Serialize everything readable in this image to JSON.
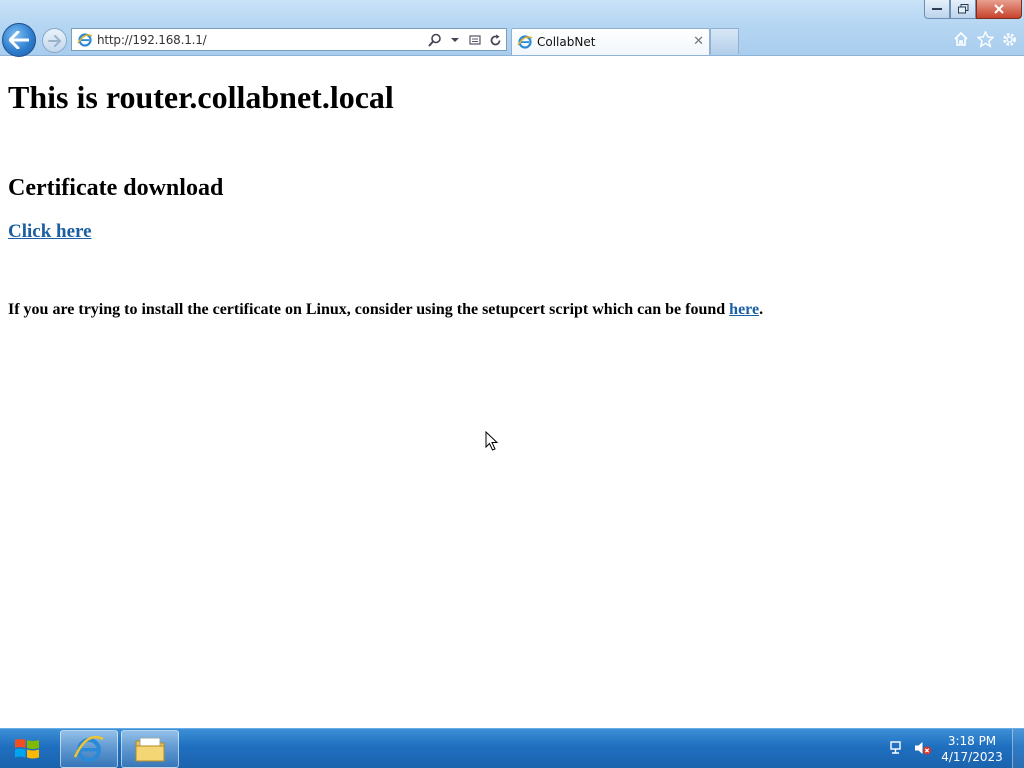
{
  "window": {
    "controls": [
      "minimize",
      "restore",
      "close"
    ]
  },
  "address_bar": {
    "url": "http://192.168.1.1/"
  },
  "tab": {
    "title": "CollabNet"
  },
  "page": {
    "heading": "This is router.collabnet.local",
    "section_heading": "Certificate download",
    "click_link": "Click here",
    "linux_note": "If you are trying to install the certificate on Linux, consider using the setupcert script which can be found ",
    "linux_link": "here",
    "linux_note_end": "."
  },
  "taskbar": {
    "time": "3:18 PM",
    "date": "4/17/2023",
    "pinned": [
      "internet-explorer",
      "file-explorer"
    ],
    "tray_icons": [
      "network-icon",
      "volume-muted-icon"
    ]
  },
  "colors": {
    "link": "#1a5fa3",
    "chrome_top": "#c9e2f7",
    "taskbar": "#1f6fc0"
  }
}
